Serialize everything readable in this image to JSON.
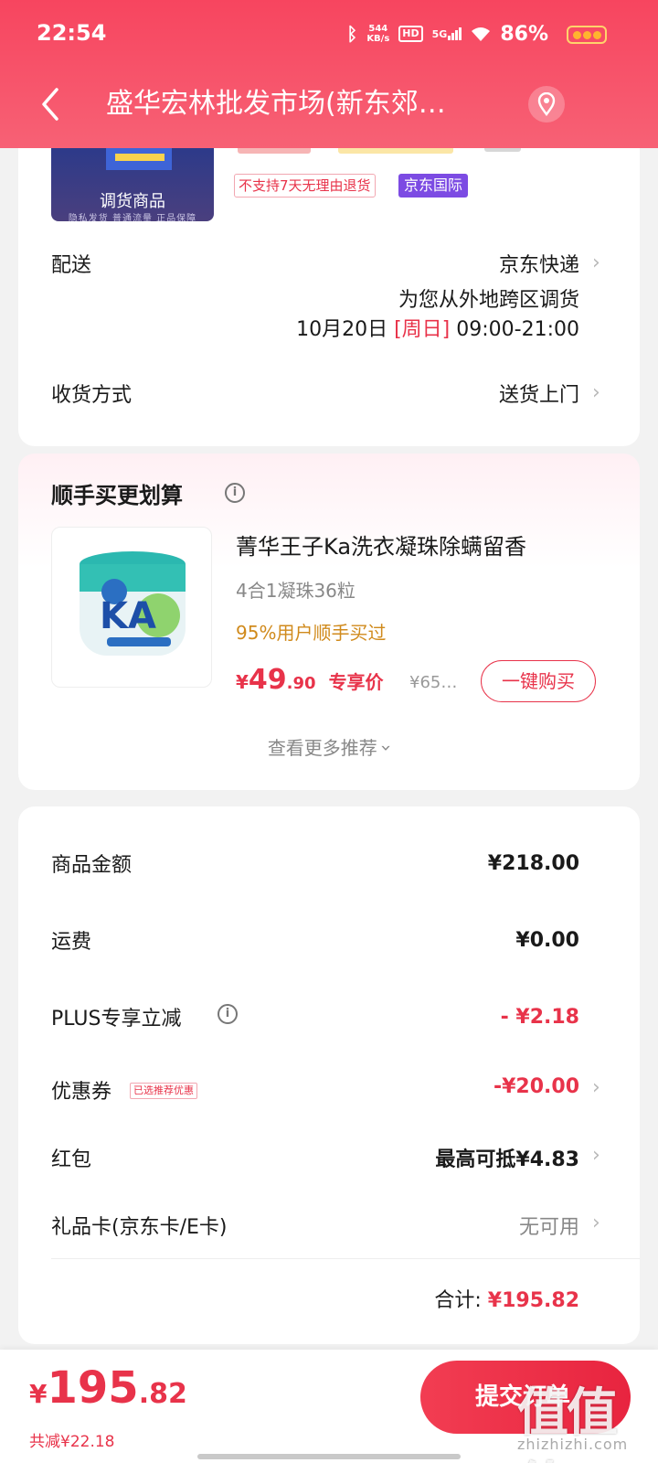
{
  "status_bar": {
    "time": "22:54",
    "net_speed_value": "544",
    "net_speed_unit": "KB/s",
    "hd": "HD",
    "network": "5G",
    "battery": "86%"
  },
  "nav": {
    "title": "盛华宏林批发市场(新东郊…"
  },
  "product": {
    "thumb_label": "调货商品",
    "thumb_sub": "隐私发货  普通流量  正品保障",
    "tag_no_return": "不支持7天无理由退货",
    "tag_intl": "京东国际"
  },
  "delivery": {
    "label": "配送",
    "carrier": "京东快递",
    "note": "为您从外地跨区调货",
    "date": "10月20日",
    "weekday": "[周日]",
    "time_range": "09:00-21:00",
    "receive_label": "收货方式",
    "receive_value": "送货上门"
  },
  "recommend": {
    "title": "顺手买更划算",
    "name": "菁华王子Ka洗衣凝珠除螨留香",
    "spec": "4合1凝珠36粒",
    "bought": "95%用户顺手买过",
    "price_symbol": "¥",
    "price_int": "49",
    "price_dec": ".90",
    "price_label": "专享价",
    "orig_price": "¥65…",
    "buy_button": "一键购买",
    "see_more": "查看更多推荐"
  },
  "summary": {
    "rows": [
      {
        "label": "商品金额",
        "value": "¥218.00"
      },
      {
        "label": "运费",
        "value": "¥0.00"
      },
      {
        "label": "PLUS专享立减",
        "value": "- ¥2.18"
      },
      {
        "label": "优惠券",
        "value": "-¥20.00",
        "tag": "已选推荐优惠"
      },
      {
        "label": "红包",
        "value": "最高可抵¥4.83"
      },
      {
        "label": "礼品卡(京东卡/E卡)",
        "value": "无可用"
      }
    ],
    "total_label": "合计:",
    "total_value": "¥195.82"
  },
  "bottom": {
    "price_symbol": "¥",
    "price_int": "195",
    "price_dec": ".82",
    "save_text": "共减¥22.18",
    "submit": "提交订单",
    "watermark": "值值值",
    "watermark_url": "zhizhizhi.com"
  },
  "colors": {
    "brand_red": "#e8334a",
    "header_gradient_top": "#f7455f",
    "intl_purple": "#7c4be3",
    "bought_orange": "#d08a1c"
  }
}
